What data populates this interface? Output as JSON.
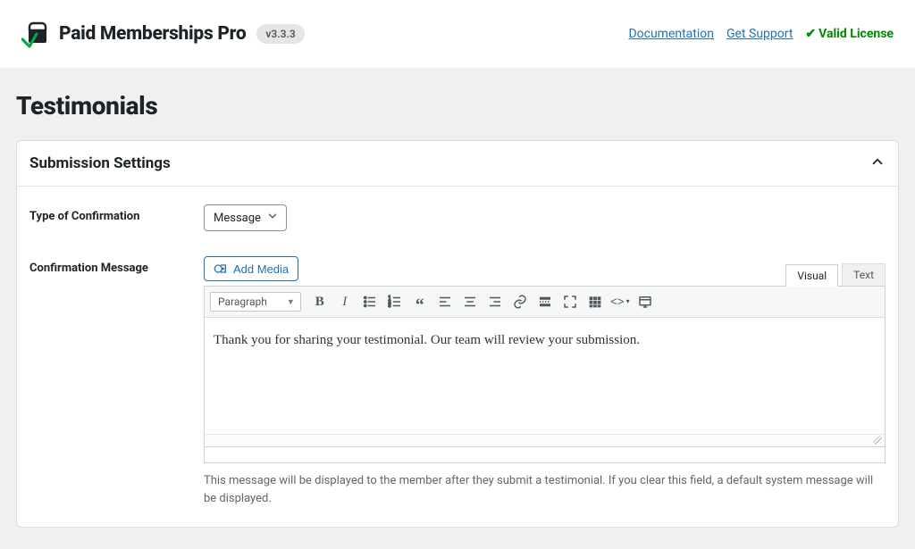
{
  "header": {
    "brand": "Paid Memberships Pro",
    "version": "v3.3.3",
    "links": {
      "docs": "Documentation",
      "support": "Get Support"
    },
    "license_label": "Valid License"
  },
  "page": {
    "title": "Testimonials"
  },
  "panel": {
    "title": "Submission Settings"
  },
  "fields": {
    "type_of_confirmation": {
      "label": "Type of Confirmation",
      "value": "Message"
    },
    "confirmation_message": {
      "label": "Confirmation Message",
      "add_media": "Add Media",
      "tabs": {
        "visual": "Visual",
        "text": "Text"
      },
      "paragraph_label": "Paragraph",
      "content": "Thank you for sharing your testimonial. Our team will review your submission.",
      "help": "This message will be displayed to the member after they submit a testimonial. If you clear this field, a default system message will be displayed."
    }
  }
}
